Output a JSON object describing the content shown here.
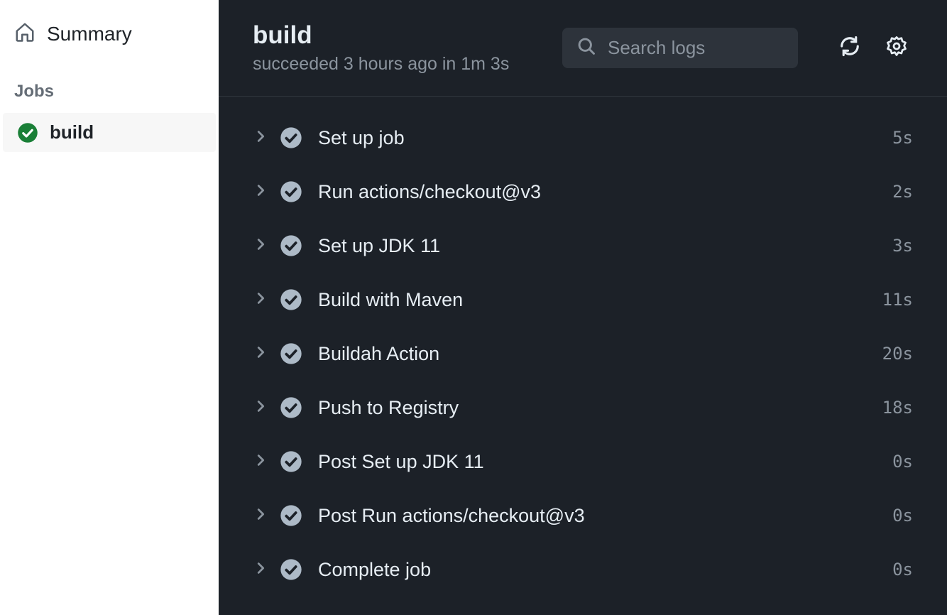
{
  "sidebar": {
    "summary_label": "Summary",
    "jobs_section_title": "Jobs",
    "jobs": [
      {
        "label": "build",
        "status": "success",
        "active": true
      }
    ]
  },
  "header": {
    "title": "build",
    "subtitle": "succeeded 3 hours ago in 1m 3s",
    "search_placeholder": "Search logs"
  },
  "steps": [
    {
      "name": "Set up job",
      "duration": "5s"
    },
    {
      "name": "Run actions/checkout@v3",
      "duration": "2s"
    },
    {
      "name": "Set up JDK 11",
      "duration": "3s"
    },
    {
      "name": "Build with Maven",
      "duration": "11s"
    },
    {
      "name": "Buildah Action",
      "duration": "20s"
    },
    {
      "name": "Push to Registry",
      "duration": "18s"
    },
    {
      "name": "Post Set up JDK 11",
      "duration": "0s"
    },
    {
      "name": "Post Run actions/checkout@v3",
      "duration": "0s"
    },
    {
      "name": "Complete job",
      "duration": "0s"
    }
  ]
}
